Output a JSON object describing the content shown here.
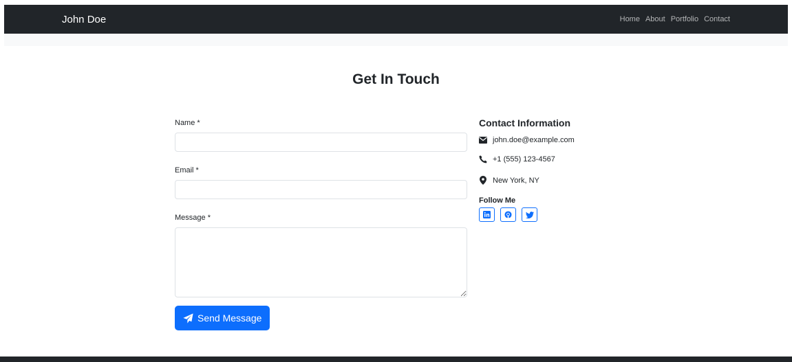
{
  "navbar": {
    "brand": "John Doe",
    "links": [
      "Home",
      "About",
      "Portfolio",
      "Contact"
    ]
  },
  "page": {
    "title": "Get In Touch"
  },
  "form": {
    "name_label": "Name *",
    "name_value": "",
    "email_label": "Email *",
    "email_value": "",
    "message_label": "Message *",
    "message_value": "",
    "submit_label": "Send Message"
  },
  "contact": {
    "title": "Contact Information",
    "email": "john.doe@example.com",
    "phone": "+1 (555) 123-4567",
    "location": "New York, NY"
  },
  "social": {
    "title": "Follow Me",
    "items": [
      "linkedin-icon",
      "github-icon",
      "twitter-icon"
    ]
  },
  "colors": {
    "navbar_bg": "#212529",
    "accent": "#0d6efd",
    "subbar_bg": "#f8f9fa"
  }
}
